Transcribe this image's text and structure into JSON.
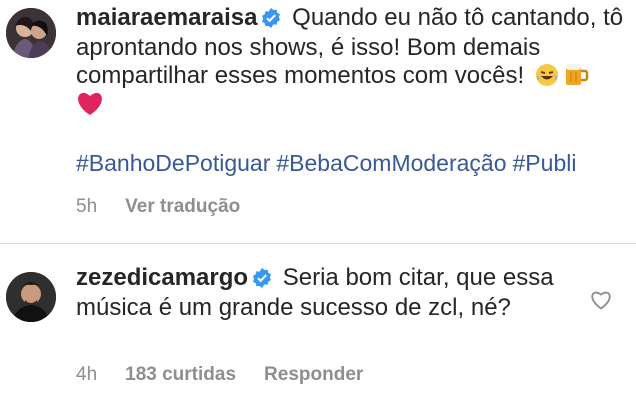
{
  "post": {
    "username": "maiaraemaraisa",
    "caption": "Quando eu não tô cantando, tô aprontando nos shows, é isso! Bom demais compartilhar esses momentos com vocês!",
    "hashtags": [
      "#BanhoDePotiguar",
      "#BebaComModeração",
      "#Publi"
    ],
    "time": "5h",
    "translate_label": "Ver tradução"
  },
  "comment": {
    "username": "zezedicamargo",
    "text": "Seria bom citar, que essa música é um grande sucesso de zcl, né?",
    "time": "4h",
    "likes_label": "183 curtidas",
    "reply_label": "Responder"
  },
  "icons": {
    "verified": "verified-badge-icon",
    "like": "heart-outline-icon",
    "emojis": [
      "laughing-tears-emoji",
      "beer-mug-emoji",
      "red-heart-emoji"
    ]
  },
  "colors": {
    "verified": "#3897f0",
    "hashtag": "#385898",
    "secondary_text": "#8e8e8e",
    "heart": "#e0245e"
  }
}
